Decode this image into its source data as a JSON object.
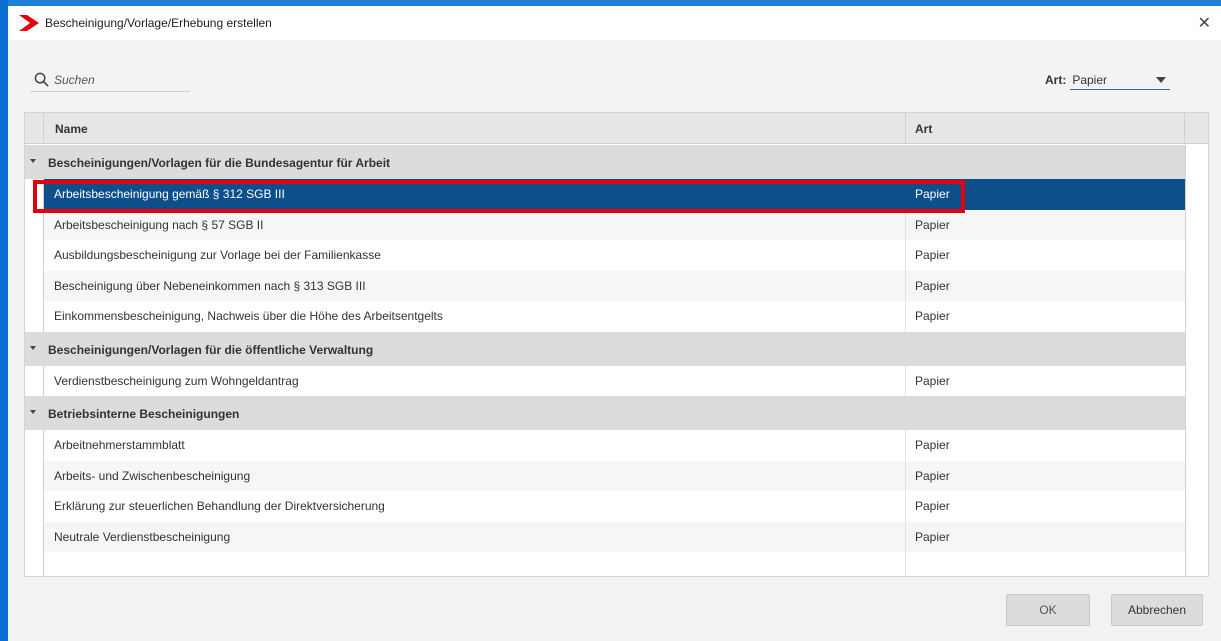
{
  "window": {
    "title": "Bescheinigung/Vorlage/Erhebung erstellen",
    "close_glyph": "✕",
    "accent_color": "#1e7fd6",
    "logo_color": "#e3000f"
  },
  "search": {
    "placeholder": "Suchen",
    "icon": "search-icon"
  },
  "filter": {
    "label": "Art:",
    "selected": "Papier"
  },
  "table": {
    "columns": {
      "name": "Name",
      "art": "Art"
    },
    "groups": [
      {
        "label": "Bescheinigungen/Vorlagen für die Bundesagentur für Arbeit",
        "rows": [
          {
            "name": "Arbeitsbescheinigung gemäß § 312 SGB III",
            "art": "Papier",
            "selected": true
          },
          {
            "name": "Arbeitsbescheinigung nach § 57 SGB II",
            "art": "Papier"
          },
          {
            "name": "Ausbildungsbescheinigung zur Vorlage bei der Familienkasse",
            "art": "Papier"
          },
          {
            "name": "Bescheinigung über Nebeneinkommen nach § 313 SGB III",
            "art": "Papier"
          },
          {
            "name": "Einkommensbescheinigung, Nachweis über die Höhe des Arbeitsentgelts",
            "art": "Papier"
          }
        ]
      },
      {
        "label": "Bescheinigungen/Vorlagen für die öffentliche Verwaltung",
        "rows": [
          {
            "name": "Verdienstbescheinigung zum Wohngeldantrag",
            "art": "Papier"
          }
        ]
      },
      {
        "label": "Betriebsinterne Bescheinigungen",
        "rows": [
          {
            "name": "Arbeitnehmerstammblatt",
            "art": "Papier"
          },
          {
            "name": "Arbeits- und Zwischenbescheinigung",
            "art": "Papier"
          },
          {
            "name": "Erklärung zur steuerlichen Behandlung der Direktversicherung",
            "art": "Papier"
          },
          {
            "name": "Neutrale Verdienstbescheinigung",
            "art": "Papier"
          }
        ]
      }
    ],
    "selected_row_color": "#0d4f8b",
    "highlight_color": "#e3000f"
  },
  "buttons": {
    "ok": "OK",
    "cancel": "Abbrechen"
  }
}
